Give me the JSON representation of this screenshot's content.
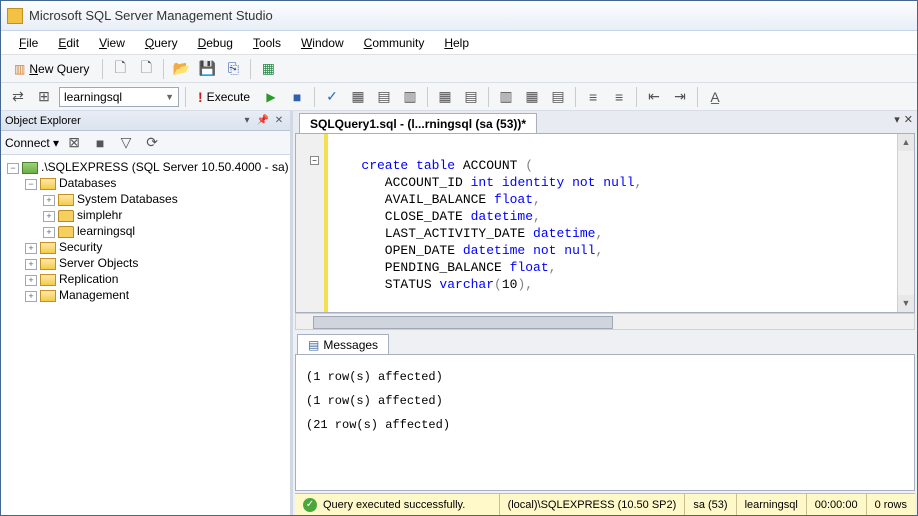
{
  "window": {
    "title": "Microsoft SQL Server Management Studio"
  },
  "menu": {
    "file": "File",
    "edit": "Edit",
    "view": "View",
    "query": "Query",
    "debug": "Debug",
    "tools": "Tools",
    "window": "Window",
    "community": "Community",
    "help": "Help"
  },
  "toolbar": {
    "new_query": "New Query",
    "db_selected": "learningsql",
    "execute": "Execute"
  },
  "object_explorer": {
    "title": "Object Explorer",
    "connect": "Connect",
    "server": ".\\SQLEXPRESS (SQL Server 10.50.4000 - sa)",
    "databases": "Databases",
    "system_databases": "System Databases",
    "db1": "simplehr",
    "db2": "learningsql",
    "security": "Security",
    "server_objects": "Server Objects",
    "replication": "Replication",
    "management": "Management"
  },
  "editor": {
    "tab_title": "SQLQuery1.sql - (l...rningsql (sa (53))*",
    "code_lines": [
      "",
      "create table ACCOUNT (",
      "   ACCOUNT_ID int identity not null,",
      "   AVAIL_BALANCE float,",
      "   CLOSE_DATE datetime,",
      "   LAST_ACTIVITY_DATE datetime,",
      "   OPEN_DATE datetime not null,",
      "   PENDING_BALANCE float,",
      "   STATUS varchar(10),"
    ]
  },
  "messages": {
    "tab": "Messages",
    "lines": [
      "(1 row(s) affected)",
      "(1 row(s) affected)",
      "(21 row(s) affected)"
    ]
  },
  "status": {
    "msg": "Query executed successfully.",
    "server": "(local)\\SQLEXPRESS (10.50 SP2)",
    "user": "sa (53)",
    "db": "learningsql",
    "time": "00:00:00",
    "rows": "0 rows"
  }
}
